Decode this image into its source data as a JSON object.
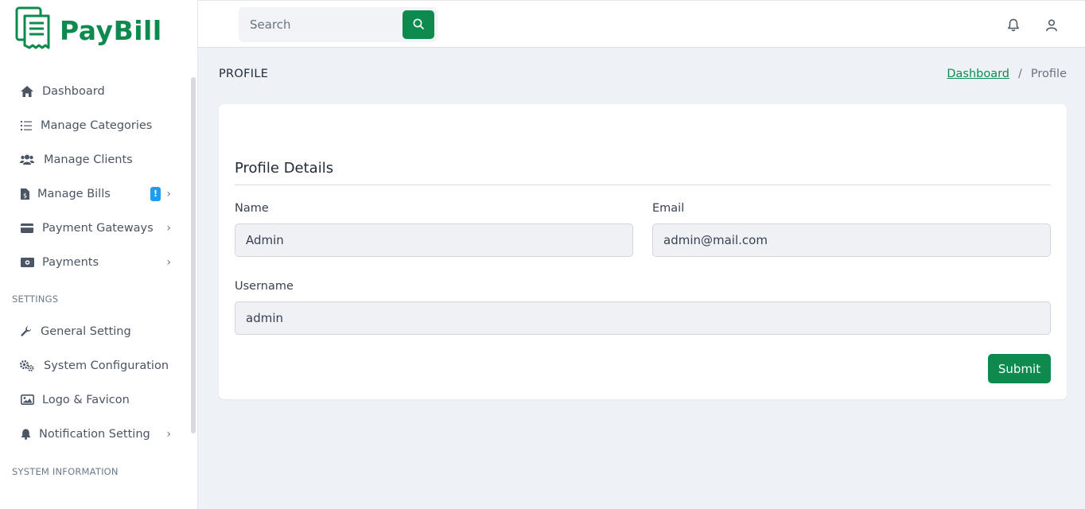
{
  "brand": {
    "name": "PayBill",
    "color": "#0e8a4e"
  },
  "search": {
    "placeholder": "Search",
    "button_icon": "search-icon"
  },
  "topbar": {
    "icons": [
      "bell-icon",
      "user-icon"
    ]
  },
  "sidebar": {
    "items": [
      {
        "label": "Dashboard",
        "icon": "home-icon"
      },
      {
        "label": "Manage Categories",
        "icon": "list-icon"
      },
      {
        "label": "Manage Clients",
        "icon": "users-icon"
      },
      {
        "label": "Manage Bills",
        "icon": "file-dollar-icon",
        "badge": "!"
      },
      {
        "label": "Payment Gateways",
        "icon": "credit-card-icon"
      },
      {
        "label": "Payments",
        "icon": "money-icon"
      }
    ],
    "settings_title": "SETTINGS",
    "settings_items": [
      {
        "label": "General Setting",
        "icon": "wrench-icon"
      },
      {
        "label": "System Configuration",
        "icon": "cogs-icon"
      },
      {
        "label": "Logo & Favicon",
        "icon": "image-icon"
      },
      {
        "label": "Notification Setting",
        "icon": "bell-icon"
      }
    ],
    "system_title": "SYSTEM INFORMATION"
  },
  "page": {
    "title": "PROFILE",
    "breadcrumb": {
      "home": "Dashboard",
      "separator": "/",
      "current": "Profile"
    }
  },
  "profile": {
    "section_title": "Profile Details",
    "name_label": "Name",
    "name_value": "Admin",
    "email_label": "Email",
    "email_value": "admin@mail.com",
    "username_label": "Username",
    "username_value": "admin",
    "submit_label": "Submit"
  }
}
